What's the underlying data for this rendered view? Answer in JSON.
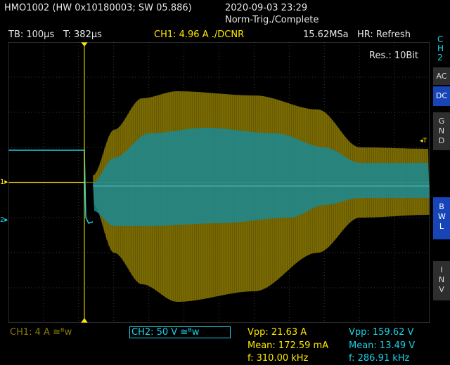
{
  "header": {
    "device": "HMO1002 (HW 0x10180003; SW 05.886)",
    "datetime": "2020-09-03 23:29",
    "trigger_status": "Norm-Trig./Complete",
    "timebase": "TB: 100µs",
    "trigger_time": "T: 382µs",
    "ch1_trigger": "CH1: 4.96 A ./DCNR",
    "sample_rate": "15.62MSa",
    "hr_mode": "HR: Refresh"
  },
  "resolution": "Res.: 10Bit",
  "side_panel": {
    "channel_label": "CH2",
    "buttons": [
      {
        "label": "AC",
        "active": false
      },
      {
        "label": "DC",
        "active": true
      },
      {
        "label": "GND",
        "active": false
      },
      {
        "label": "BWL",
        "active": true
      },
      {
        "label": "INV",
        "active": false
      }
    ]
  },
  "markers": {
    "ch1": "1",
    "ch2": "2",
    "trigger_level": "T"
  },
  "footer": {
    "ch1_setting": "CH1: 4 A ≅ᴮw",
    "ch2_setting": "CH2: 50 V ≅ᴮw",
    "ch1_measurements": {
      "vpp": "Vpp: 21.63 A",
      "mean": "Mean: 172.59 mA",
      "freq": "f: 310.00 kHz"
    },
    "ch2_measurements": {
      "vpp": "Vpp: 159.62 V",
      "mean": "Mean: 13.49 V",
      "freq": "f: 286.91 kHz"
    }
  },
  "colors": {
    "ch1": "#ffe800",
    "ch2": "#19d2e6",
    "ch1_envelope": "#7a6a00",
    "ch2_envelope": "#1b8a90",
    "grid": "#3a3a3a",
    "background": "#000000"
  }
}
